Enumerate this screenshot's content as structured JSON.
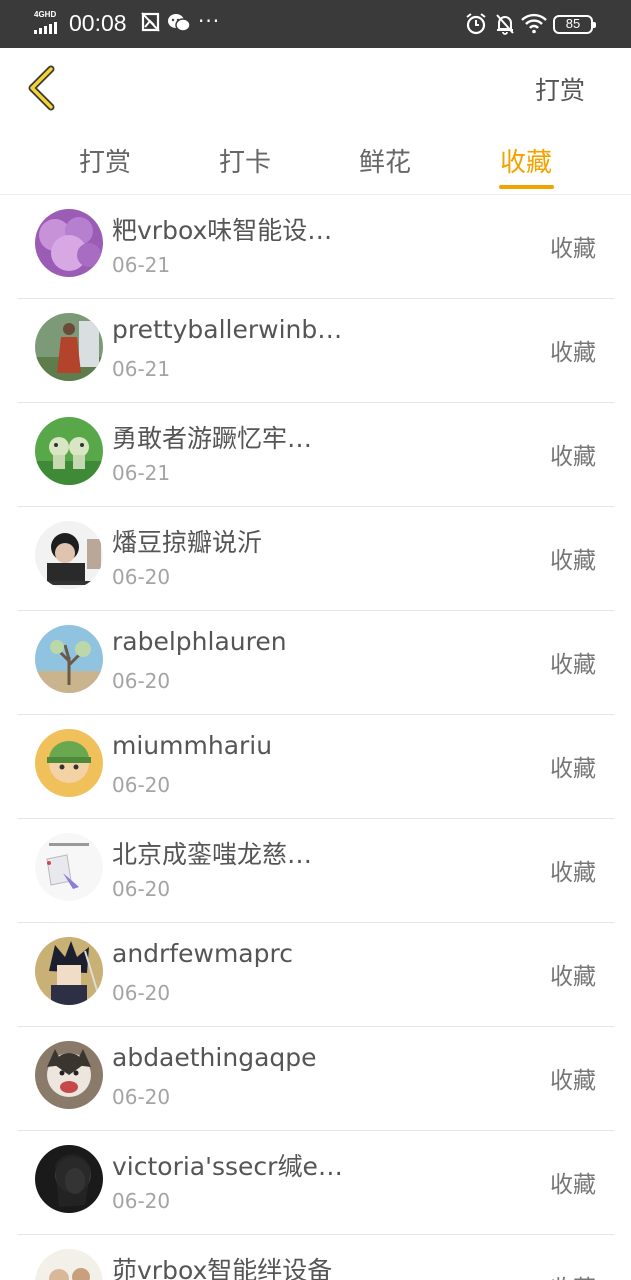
{
  "status_bar": {
    "network": "4GHD",
    "time": "00:08",
    "more": "···",
    "battery": "85"
  },
  "header": {
    "action_label": "打赏"
  },
  "tabs": [
    {
      "label": "打赏",
      "active": false
    },
    {
      "label": "打卡",
      "active": false
    },
    {
      "label": "鲜花",
      "active": false
    },
    {
      "label": "收藏",
      "active": true
    }
  ],
  "accent_color": "#f2a300",
  "list": [
    {
      "name": "粑vrbox味智能设…",
      "date": "06-21",
      "action": "收藏"
    },
    {
      "name": "prettyballerwinb…",
      "date": "06-21",
      "action": "收藏"
    },
    {
      "name": "勇敢者游蹶忆牢…",
      "date": "06-21",
      "action": "收藏"
    },
    {
      "name": "燔豆掠瓣说沂",
      "date": "06-20",
      "action": "收藏"
    },
    {
      "name": "rabelphlauren",
      "date": "06-20",
      "action": "收藏"
    },
    {
      "name": "miummhariu",
      "date": "06-20",
      "action": "收藏"
    },
    {
      "name": "北京成銮嗤龙慈…",
      "date": "06-20",
      "action": "收藏"
    },
    {
      "name": "andrfewmaprc",
      "date": "06-20",
      "action": "收藏"
    },
    {
      "name": "abdaethingaqpe",
      "date": "06-20",
      "action": "收藏"
    },
    {
      "name": "victoria'ssecr缄e…",
      "date": "06-20",
      "action": "收藏"
    },
    {
      "name": "茆vrbox智能绊设备",
      "date": "",
      "action": "收藏"
    }
  ]
}
